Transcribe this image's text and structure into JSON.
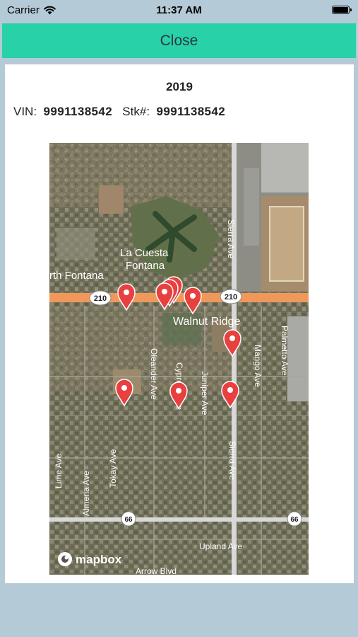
{
  "status_bar": {
    "carrier": "Carrier",
    "time": "11:37 AM"
  },
  "header": {
    "close_label": "Close"
  },
  "vehicle": {
    "year": "2019",
    "vin_label": "VIN:",
    "vin": "9991138542",
    "stock_label": "Stk#:",
    "stock": "9991138542"
  },
  "map": {
    "attribution": "mapbox",
    "place_labels": {
      "la_cuesta": "La Cuesta",
      "fontana": "Fontana",
      "north_fontana": "rth Fontana",
      "walnut_ridge": "Walnut Ridge"
    },
    "street_labels": {
      "sierra_ave_north": "Sierra Ave",
      "sierra_ave_south": "Sierra Ave",
      "palmetto_ave": "Palmetto Ave",
      "mango_ave": "Mango Ave",
      "oleander_ave": "Oleander Ave",
      "cypress_ave": "Cypress Ave",
      "juniper_ave": "Juniper Ave",
      "lime_ave": "Lime Ave",
      "almeria_ave": "Almeria Ave",
      "tokay_ave": "Tokay Ave",
      "upland_ave": "Upland Ave",
      "arrow_blvd": "Arrow Blvd"
    },
    "route_shields": {
      "i210_west": "210",
      "i210_east": "210",
      "r66_west": "66",
      "r66_east": "66"
    },
    "marker_count": 10,
    "colors": {
      "marker": "#e8403f",
      "freeway": "#f0985a",
      "close_button": "#28d1a8"
    }
  }
}
